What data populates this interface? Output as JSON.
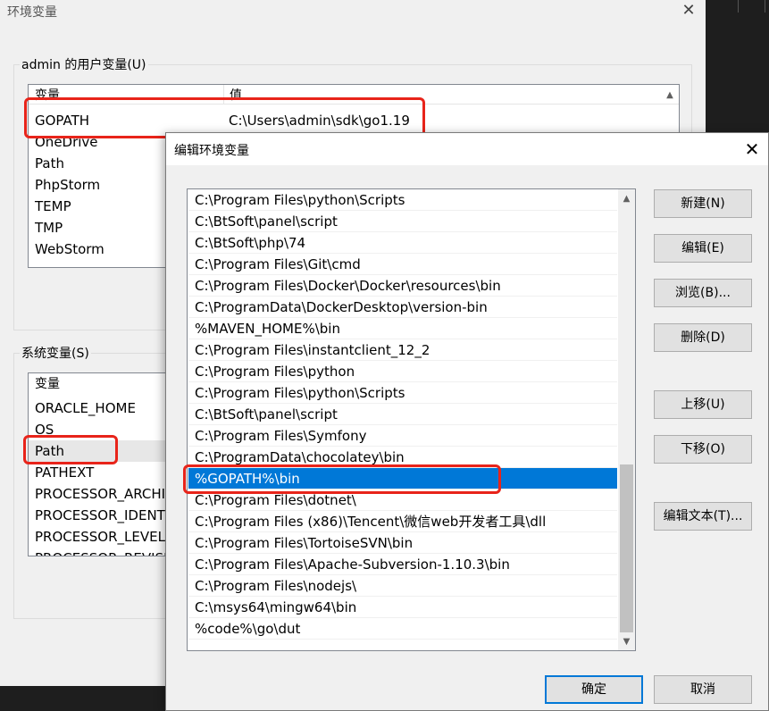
{
  "parent_window": {
    "title": "环境变量",
    "user_group": {
      "label": "admin 的用户变量(U)",
      "header": {
        "col_var": "变量",
        "col_val": "值"
      },
      "rows": [
        {
          "name": "GOPATH",
          "value": "C:\\Users\\admin\\sdk\\go1.19"
        },
        {
          "name": "OneDrive",
          "value": ""
        },
        {
          "name": "Path",
          "value": ""
        },
        {
          "name": "PhpStorm",
          "value": ""
        },
        {
          "name": "TEMP",
          "value": ""
        },
        {
          "name": "TMP",
          "value": ""
        },
        {
          "name": "WebStorm",
          "value": ""
        }
      ]
    },
    "system_group": {
      "label": "系统变量(S)",
      "header": {
        "col_var": "变量"
      },
      "rows": [
        {
          "name": "ORACLE_HOME"
        },
        {
          "name": "OS"
        },
        {
          "name": "Path"
        },
        {
          "name": "PATHEXT"
        },
        {
          "name": "PROCESSOR_ARCHIT"
        },
        {
          "name": "PROCESSOR_IDENTI"
        },
        {
          "name": "PROCESSOR_LEVEL"
        },
        {
          "name": "PROCESSOR_REVISI"
        }
      ]
    }
  },
  "dialog": {
    "title": "编辑环境变量",
    "selected_index": 13,
    "entries": [
      "C:\\Program Files\\python\\Scripts",
      "C:\\BtSoft\\panel\\script",
      "C:\\BtSoft\\php\\74",
      "C:\\Program Files\\Git\\cmd",
      "C:\\Program Files\\Docker\\Docker\\resources\\bin",
      "C:\\ProgramData\\DockerDesktop\\version-bin",
      "%MAVEN_HOME%\\bin",
      "C:\\Program Files\\instantclient_12_2",
      "C:\\Program Files\\python",
      "C:\\Program Files\\python\\Scripts",
      "C:\\BtSoft\\panel\\script",
      "C:\\Program Files\\Symfony",
      "C:\\ProgramData\\chocolatey\\bin",
      "%GOPATH%\\bin",
      "C:\\Program Files\\dotnet\\",
      "C:\\Program Files (x86)\\Tencent\\微信web开发者工具\\dll",
      "C:\\Program Files\\TortoiseSVN\\bin",
      "C:\\Program Files\\Apache-Subversion-1.10.3\\bin",
      "C:\\Program Files\\nodejs\\",
      "C:\\msys64\\mingw64\\bin",
      "%code%\\go\\dut"
    ],
    "buttons": {
      "new": "新建(N)",
      "edit": "编辑(E)",
      "browse": "浏览(B)...",
      "delete": "删除(D)",
      "move_up": "上移(U)",
      "move_down": "下移(O)",
      "edit_text": "编辑文本(T)...",
      "ok": "确定",
      "cancel": "取消"
    }
  },
  "colors": {
    "highlight_box": "#e8241a",
    "selection": "#0078d7"
  }
}
